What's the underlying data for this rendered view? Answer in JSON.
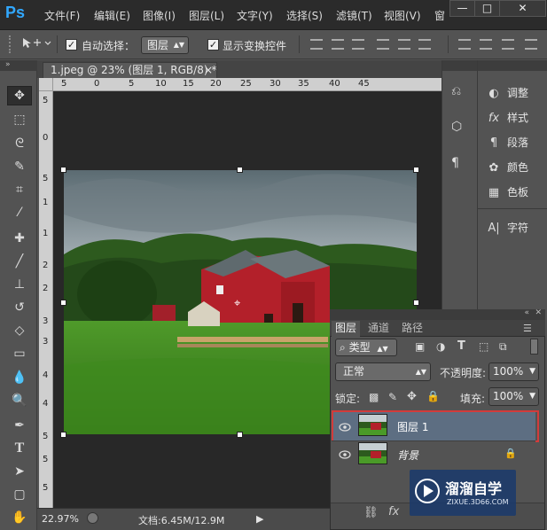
{
  "app": {
    "logo": "Ps"
  },
  "menu": [
    "文件(F)",
    "编辑(E)",
    "图像(I)",
    "图层(L)",
    "文字(Y)",
    "选择(S)",
    "滤镜(T)",
    "视图(V)",
    "窗"
  ],
  "window_controls": {
    "minimize": "—",
    "maximize": "□",
    "close": "✕"
  },
  "options": {
    "auto_select_label": "自动选择：",
    "auto_select_checked": "✓",
    "auto_select_value": "图层",
    "show_transform_label": "显示变换控件",
    "show_transform_checked": "✓"
  },
  "document": {
    "tab_title": "1.jpeg @ 23% (图层 1, RGB/8) *",
    "tab_close": "×"
  },
  "rulers": {
    "top": [
      "5",
      "0",
      "5",
      "10",
      "15",
      "20",
      "25",
      "30",
      "35",
      "40",
      "45"
    ],
    "left": [
      "5",
      "0",
      "5",
      "1",
      "1",
      "2",
      "2",
      "3",
      "3",
      "4",
      "4",
      "5",
      "5",
      "5"
    ]
  },
  "status": {
    "zoom": "22.97%",
    "doc_info": "文档:6.45M/12.9M",
    "arrow": "▶"
  },
  "right_panels": [
    {
      "icon": "adjust-icon",
      "glyph": "◐",
      "label": "调整"
    },
    {
      "icon": "fx-style-icon",
      "glyph": "fx",
      "label": "样式"
    },
    {
      "icon": "paragraph-icon",
      "glyph": "¶",
      "label": "段落"
    },
    {
      "icon": "palette-icon",
      "glyph": "✿",
      "label": "颜色"
    },
    {
      "icon": "swatches-icon",
      "glyph": "▦",
      "label": "色板"
    },
    {
      "icon": "character-icon",
      "glyph": "A|",
      "label": "字符"
    }
  ],
  "layers_panel": {
    "tabs": [
      "图层",
      "通道",
      "路径"
    ],
    "active_tab": "图层",
    "filter_kind": "类型",
    "blend_mode": "正常",
    "opacity_label": "不透明度:",
    "opacity_value": "100%",
    "lock_label": "锁定:",
    "fill_label": "填充:",
    "fill_value": "100%",
    "layers": [
      {
        "name": "图层 1",
        "selected": true,
        "locked": false
      },
      {
        "name": "背景",
        "selected": false,
        "locked": true
      }
    ],
    "footer_icons": [
      "link-icon",
      "fx-icon"
    ]
  },
  "watermark": {
    "brand": "溜溜自学",
    "url": "ZIXUE.3D66.COM"
  },
  "colors": {
    "accent": "#31a8ff",
    "selection_outline": "#d23b3b",
    "selected_layer": "#5d6e82"
  }
}
